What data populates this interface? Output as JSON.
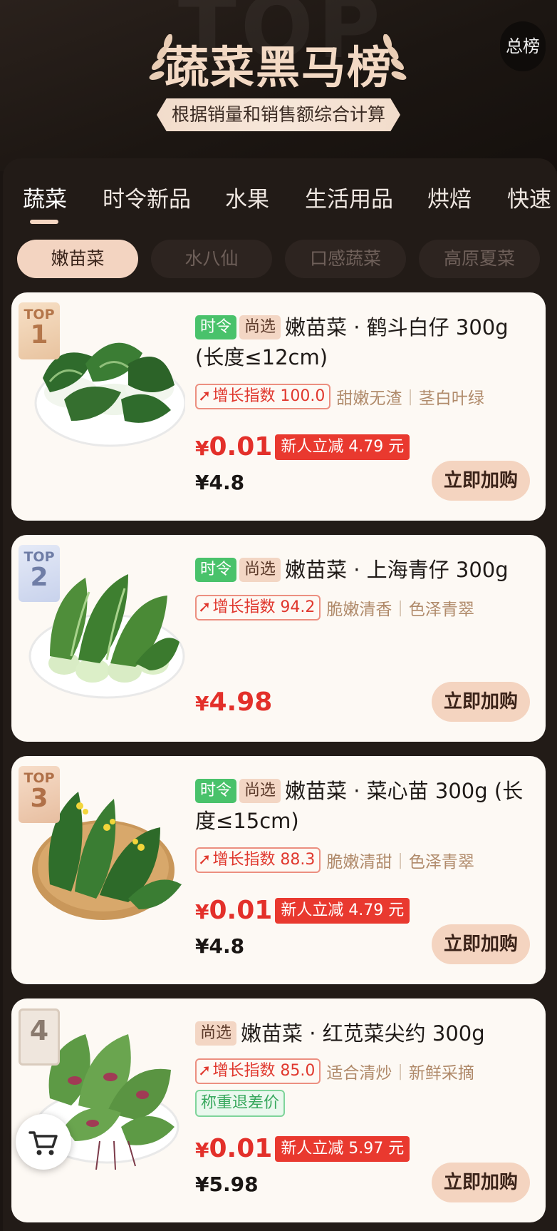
{
  "header": {
    "watermark": "TOP",
    "title": "蔬菜黑马榜",
    "subtitle": "根据销量和销售额综合计算",
    "rank_button": "总榜"
  },
  "tabs": [
    "蔬菜",
    "时令新品",
    "水果",
    "生活用品",
    "烘焙",
    "快速"
  ],
  "chips": [
    "嫩苗菜",
    "水八仙",
    "口感蔬菜",
    "高原夏菜"
  ],
  "products": [
    {
      "rank_top": "TOP",
      "rank": "1",
      "tag_season": "时令",
      "tag_select": "尚选",
      "title": "嫩苗菜 · 鹤斗白仔 300g (长度≤12cm)",
      "growth": "增长指数 100.0",
      "feat1": "甜嫩无渣",
      "feat2": "茎白叶绿",
      "price": "0.01",
      "discount": "新人立减 4.79 元",
      "old_price": "¥4.8",
      "buy": "立即加购"
    },
    {
      "rank_top": "TOP",
      "rank": "2",
      "tag_season": "时令",
      "tag_select": "尚选",
      "title": "嫩苗菜 · 上海青仔 300g",
      "growth": "增长指数 94.2",
      "feat1": "脆嫩清香",
      "feat2": "色泽青翠",
      "price": "4.98",
      "buy": "立即加购"
    },
    {
      "rank_top": "TOP",
      "rank": "3",
      "tag_season": "时令",
      "tag_select": "尚选",
      "title": "嫩苗菜 · 菜心苗 300g (长度≤15cm)",
      "growth": "增长指数 88.3",
      "feat1": "脆嫩清甜",
      "feat2": "色泽青翠",
      "price": "0.01",
      "discount": "新人立减 4.79 元",
      "old_price": "¥4.8",
      "buy": "立即加购"
    },
    {
      "rank": "4",
      "tag_select": "尚选",
      "title": "嫩苗菜 · 红苋菜尖约 300g",
      "growth": "增长指数 85.0",
      "feat1": "适合清炒",
      "feat2": "新鲜采摘",
      "refund": "称重退差价",
      "price": "0.01",
      "discount": "新人立减 5.97 元",
      "old_price": "¥5.98",
      "buy": "立即加购"
    }
  ],
  "currency": "¥",
  "icons": {
    "laurel": "laurel-icon",
    "arrow": "growth-arrow-icon",
    "cart": "cart-icon"
  },
  "colors": {
    "accent": "#f3d4c1",
    "price_red": "#e3302a",
    "season_green": "#49c26b",
    "background": "#1b1512",
    "card": "#fdf9f4"
  }
}
